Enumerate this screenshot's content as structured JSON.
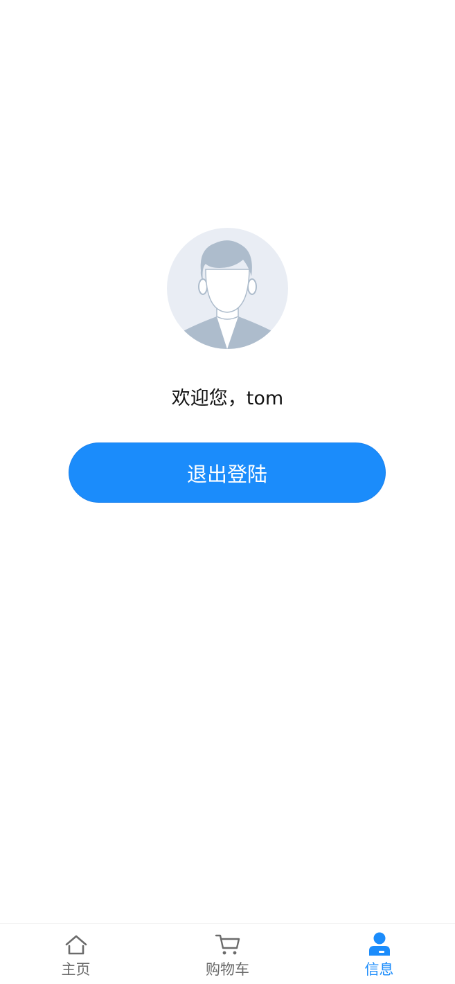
{
  "profile": {
    "welcome_text": "欢迎您，tom",
    "avatar_icon": "default-user-avatar"
  },
  "actions": {
    "logout_label": "退出登陆"
  },
  "tabbar": {
    "items": [
      {
        "label": "主页",
        "icon": "home-icon",
        "active": false
      },
      {
        "label": "购物车",
        "icon": "cart-icon",
        "active": false
      },
      {
        "label": "信息",
        "icon": "user-icon",
        "active": true
      }
    ]
  },
  "colors": {
    "primary": "#1b8cfb",
    "tab_inactive": "#6b6b6b",
    "avatar_bg": "#e9edf4",
    "avatar_figure": "#adbccc"
  }
}
